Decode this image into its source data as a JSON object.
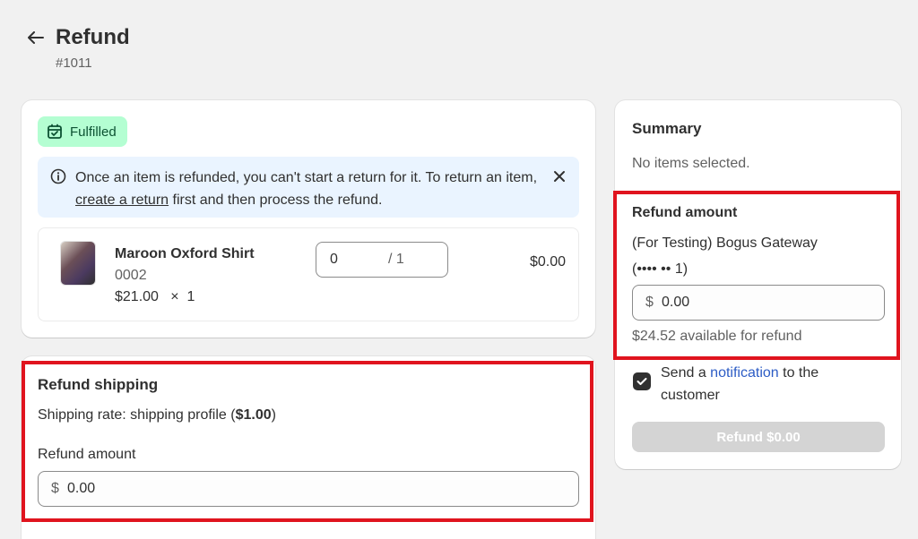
{
  "header": {
    "title": "Refund",
    "order_number": "#1011"
  },
  "fulfillment": {
    "badge_label": "Fulfilled",
    "banner_text_1": "Once an item is refunded, you can't start a return for it. To return an item,",
    "banner_link": "create a return",
    "banner_text_2": "first and then process the refund."
  },
  "line_item": {
    "name": "Maroon Oxford Shirt",
    "sku": "0002",
    "unit_price": "$21.00",
    "multiply": "×",
    "ordered_qty": "1",
    "refund_qty": "0",
    "max_qty": "/ 1",
    "total": "$0.00"
  },
  "refund_shipping": {
    "heading": "Refund shipping",
    "rate_prefix": "Shipping rate: shipping profile (",
    "rate_amount": "$1.00",
    "rate_suffix": ")",
    "amount_label": "Refund amount",
    "currency": "$",
    "amount_value": "0.00"
  },
  "summary": {
    "heading": "Summary",
    "no_items": "No items selected.",
    "refund_heading": "Refund amount",
    "gateway": "(For Testing) Bogus Gateway",
    "card_mask": "(•••• •• 1)",
    "currency": "$",
    "amount_value": "0.00",
    "available": "$24.52 available for refund",
    "notify_prefix": "Send a",
    "notify_link": "notification",
    "notify_suffix": "to the customer",
    "notify_checked": true,
    "refund_button": "Refund $0.00"
  },
  "icons": {
    "back": "arrow-left-icon",
    "badge": "package-fulfilled-icon",
    "info": "info-circle-icon",
    "close": "close-icon",
    "check": "checkmark-icon"
  },
  "colors": {
    "badge_bg": "#b4fed2",
    "banner_bg": "#eaf4ff",
    "link_blue": "#2c5cc5",
    "highlight_red": "#e0141e",
    "disabled_button": "#d4d4d4"
  }
}
